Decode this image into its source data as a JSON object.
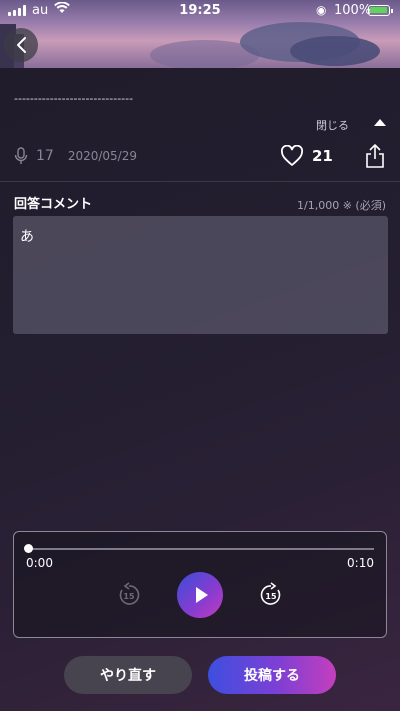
{
  "status_bar": {
    "carrier": "au",
    "time": "19:25",
    "battery": "100%"
  },
  "post": {
    "text": "------------------------------",
    "close_label": "閉じる",
    "play_count": "17",
    "date": "2020/05/29",
    "like_count": "21"
  },
  "comment": {
    "title": "回答コメント",
    "counter": "1/1,000 ※ (必須)",
    "value": "あ"
  },
  "player": {
    "current_time": "0:00",
    "total_time": "0:10",
    "skip_back_seconds": "15",
    "skip_forward_seconds": "15",
    "progress": 0
  },
  "actions": {
    "retry_label": "やり直す",
    "post_label": "投稿する"
  },
  "colors": {
    "accent_start": "#3d4fe0",
    "accent_end": "#c43fbd",
    "battery": "#5fd35b"
  }
}
